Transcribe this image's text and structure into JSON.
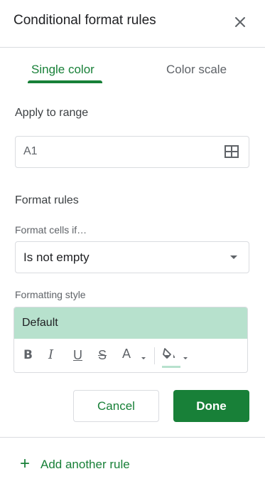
{
  "panel": {
    "title": "Conditional format rules",
    "close_icon": "close-icon"
  },
  "tabs": [
    {
      "label": "Single color",
      "active": true
    },
    {
      "label": "Color scale",
      "active": false
    }
  ],
  "apply_to_range": {
    "label": "Apply to range",
    "value": "A1",
    "icon": "grid-select-icon"
  },
  "format_rules": {
    "label": "Format rules",
    "condition_label": "Format cells if…",
    "condition_value": "Is not empty"
  },
  "formatting_style": {
    "label": "Formatting style",
    "preview_text": "Default",
    "preview_background": "#b7e1cd",
    "toolbar": {
      "bold": "B",
      "italic": "I",
      "underline": "U",
      "strikethrough": "S",
      "text_color": "A",
      "fill_color_icon": "paint-bucket-icon"
    }
  },
  "buttons": {
    "cancel": "Cancel",
    "done": "Done"
  },
  "add_rule": {
    "plus": "+",
    "label": "Add another rule"
  },
  "colors": {
    "accent": "#188038",
    "border": "#dadce0"
  }
}
